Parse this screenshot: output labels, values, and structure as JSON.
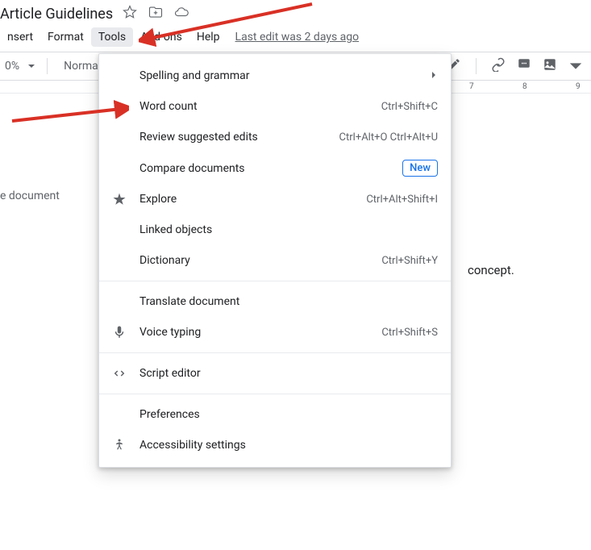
{
  "doc_title": "Article Guidelines",
  "menubar": {
    "insert": "nsert",
    "format": "Format",
    "tools": "Tools",
    "addons": "Add-ons",
    "help": "Help"
  },
  "last_edit": "Last edit was 2 days ago",
  "toolbar": {
    "zoom": "0%",
    "style": "Normal"
  },
  "outline": {
    "empty": "e document"
  },
  "body_text": "concept.",
  "ruler": {
    "t7": "7",
    "t8": "8",
    "t9": "9"
  },
  "tools_menu": {
    "spelling": {
      "label": "Spelling and grammar"
    },
    "wordcount": {
      "label": "Word count",
      "shortcut": "Ctrl+Shift+C"
    },
    "review": {
      "label": "Review suggested edits",
      "shortcut": "Ctrl+Alt+O Ctrl+Alt+U"
    },
    "compare": {
      "label": "Compare documents",
      "badge": "New"
    },
    "explore": {
      "label": "Explore",
      "shortcut": "Ctrl+Alt+Shift+I"
    },
    "linked": {
      "label": "Linked objects"
    },
    "dictionary": {
      "label": "Dictionary",
      "shortcut": "Ctrl+Shift+Y"
    },
    "translate": {
      "label": "Translate document"
    },
    "voice": {
      "label": "Voice typing",
      "shortcut": "Ctrl+Shift+S"
    },
    "script": {
      "label": "Script editor"
    },
    "preferences": {
      "label": "Preferences"
    },
    "accessibility": {
      "label": "Accessibility settings"
    }
  }
}
